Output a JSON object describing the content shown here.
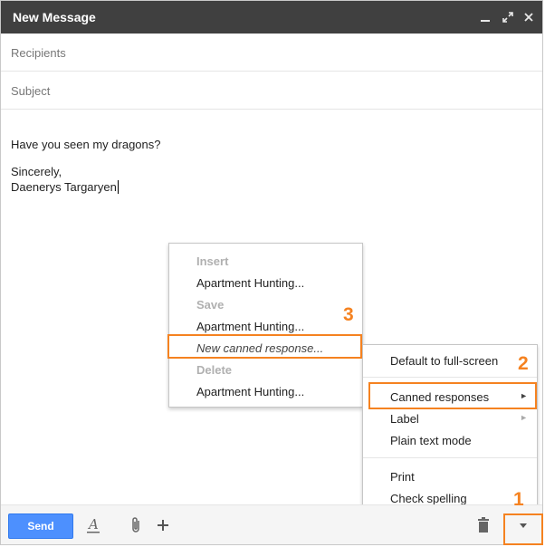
{
  "window": {
    "title": "New Message",
    "controls": [
      "minimize-icon",
      "popout-icon",
      "close-icon"
    ]
  },
  "fields": {
    "recipients_placeholder": "Recipients",
    "subject_placeholder": "Subject"
  },
  "body": {
    "line1": "Have you seen my dragons?",
    "line2": "Sincerely,",
    "line3": "Daenerys Targaryen"
  },
  "options_menu": {
    "default_fullscreen": "Default to full-screen",
    "canned_responses": "Canned responses",
    "label": "Label",
    "plain_text": "Plain text mode",
    "print": "Print",
    "check_spelling": "Check spelling"
  },
  "canned_menu": {
    "insert_header": "Insert",
    "insert_item": "Apartment Hunting...",
    "save_header": "Save",
    "save_item": "Apartment Hunting...",
    "new_response": "New canned response...",
    "delete_header": "Delete",
    "delete_item": "Apartment Hunting..."
  },
  "footer": {
    "send_label": "Send",
    "icons": [
      "formatting-icon",
      "attach-icon",
      "insert-plus-icon",
      "trash-icon",
      "more-options-icon"
    ]
  },
  "annotations": {
    "step1": "1",
    "step2": "2",
    "step3": "3"
  },
  "colors": {
    "titlebar": "#404040",
    "send_button": "#4d90fe",
    "annotation": "#f58220"
  }
}
